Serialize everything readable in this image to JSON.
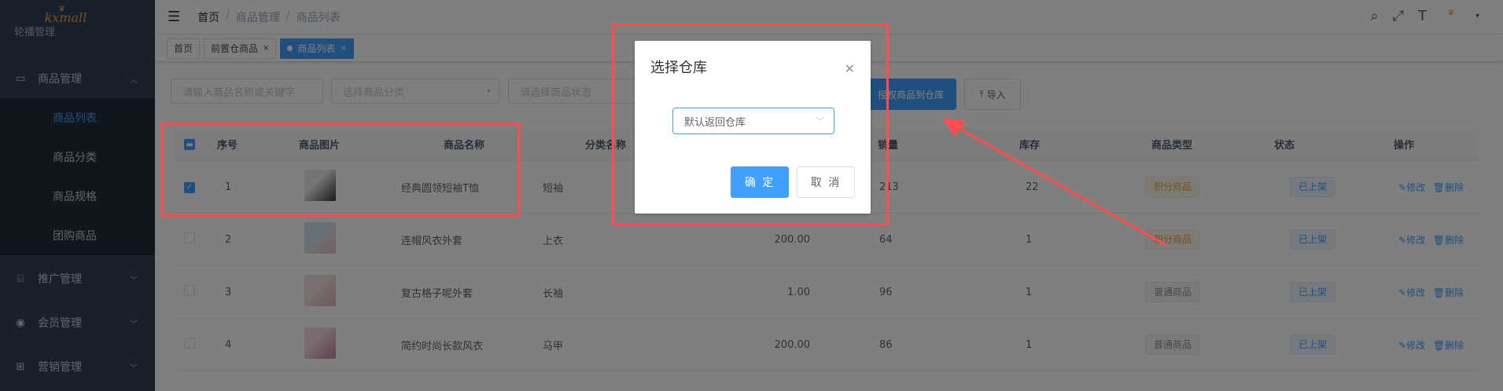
{
  "sidebar": {
    "logo": "kxmall",
    "partial_item": "轮播管理",
    "menu": [
      {
        "label": "商品管理",
        "icon": "monitor-icon"
      },
      {
        "label": "推广管理",
        "icon": "promo-icon"
      },
      {
        "label": "会员管理",
        "icon": "github-icon"
      },
      {
        "label": "营销管理",
        "icon": "marketing-icon"
      }
    ],
    "submenu": [
      "商品列表",
      "商品分类",
      "商品规格",
      "团购商品"
    ]
  },
  "navbar": {
    "breadcrumb": [
      "首页",
      "商品管理",
      "商品列表"
    ]
  },
  "tags": [
    {
      "label": "首页",
      "closable": false,
      "active": false
    },
    {
      "label": "前置仓商品",
      "closable": true,
      "active": false
    },
    {
      "label": "商品列表",
      "closable": true,
      "active": true
    }
  ],
  "filters": {
    "keyword_placeholder": "请输入商品名称或关键字",
    "category_placeholder": "选择商品分类",
    "status_placeholder": "请选择商品状态"
  },
  "buttons": {
    "authorize": "授权商品到仓库",
    "import": "导入"
  },
  "table": {
    "headers": {
      "index": "序号",
      "image": "商品图片",
      "name": "商品名称",
      "category": "分类名称",
      "sales": "销量",
      "stock": "库存",
      "type": "商品类型",
      "status": "状态",
      "ops": "操作"
    },
    "rows": [
      {
        "index": "1",
        "name": "经典圆领短袖T恤",
        "category": "短袖",
        "price": "",
        "sales": "213",
        "stock": "22",
        "type": "积分商品",
        "status": "已上架",
        "checked": true
      },
      {
        "index": "2",
        "name": "连帽风衣外套",
        "category": "上衣",
        "price": "200.00",
        "sales": "64",
        "stock": "1",
        "type": "积分商品",
        "status": "已上架",
        "checked": false
      },
      {
        "index": "3",
        "name": "复古格子呢外套",
        "category": "长袖",
        "price": "1.00",
        "sales": "96",
        "stock": "1",
        "type": "普通商品",
        "status": "已上架",
        "checked": false
      },
      {
        "index": "4",
        "name": "简约时尚长款风衣",
        "category": "马甲",
        "price": "200.00",
        "sales": "86",
        "stock": "1",
        "type": "普通商品",
        "status": "已上架",
        "checked": false
      }
    ],
    "op_edit": "修改",
    "op_delete": "删除"
  },
  "dialog": {
    "title": "选择仓库",
    "selected": "默认返回仓库",
    "ok": "确 定",
    "cancel": "取 消"
  },
  "colors": {
    "primary": "#409eff",
    "sidebar": "#304156",
    "annotation": "#ff4d4f"
  }
}
